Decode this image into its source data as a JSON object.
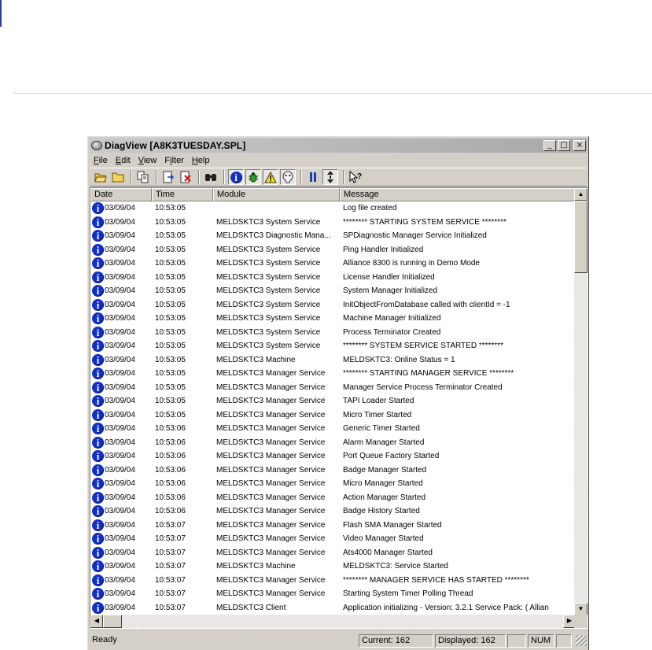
{
  "window": {
    "title": "DiagView [A8K3TUESDAY.SPL]"
  },
  "window_buttons": [
    "minimize",
    "maximize",
    "close"
  ],
  "menu": [
    {
      "label": "File",
      "key": "F"
    },
    {
      "label": "Edit",
      "key": "E"
    },
    {
      "label": "View",
      "key": "V"
    },
    {
      "label": "Filter",
      "key": "i"
    },
    {
      "label": "Help",
      "key": "H"
    }
  ],
  "toolbar": [
    "open-folder-icon",
    "folder-icon",
    "copy-icon",
    "export-icon",
    "delete-icon",
    "find-icon",
    "info-filter-icon",
    "debug-filter-icon",
    "warning-filter-icon",
    "error-filter-icon",
    "pause-icon",
    "autoscroll-icon",
    "context-help-icon"
  ],
  "columns": {
    "date": "Date",
    "time": "Time",
    "module": "Module",
    "message": "Message"
  },
  "rows": [
    {
      "date": "03/09/04",
      "time": "10:53:05",
      "module": "",
      "message": "Log file created"
    },
    {
      "date": "03/09/04",
      "time": "10:53:05",
      "module": "MELDSKTC3 System Service",
      "message": "********  STARTING SYSTEM SERVICE  ********"
    },
    {
      "date": "03/09/04",
      "time": "10:53:05",
      "module": "MELDSKTC3 Diagnostic Mana...",
      "message": "SPDiagnostic Manager Service Initialized"
    },
    {
      "date": "03/09/04",
      "time": "10:53:05",
      "module": "MELDSKTC3 System Service",
      "message": "Ping Handler Initialized"
    },
    {
      "date": "03/09/04",
      "time": "10:53:05",
      "module": "MELDSKTC3 System Service",
      "message": "Alliance 8300 is running in Demo Mode"
    },
    {
      "date": "03/09/04",
      "time": "10:53:05",
      "module": "MELDSKTC3 System Service",
      "message": "License Handler Initialized"
    },
    {
      "date": "03/09/04",
      "time": "10:53:05",
      "module": "MELDSKTC3 System Service",
      "message": "System Manager Initialized"
    },
    {
      "date": "03/09/04",
      "time": "10:53:05",
      "module": "MELDSKTC3 System Service",
      "message": "InitObjectFromDatabase called with clientId = -1"
    },
    {
      "date": "03/09/04",
      "time": "10:53:05",
      "module": "MELDSKTC3 System Service",
      "message": "Machine Manager Initialized"
    },
    {
      "date": "03/09/04",
      "time": "10:53:05",
      "module": "MELDSKTC3 System Service",
      "message": "Process Terminator Created"
    },
    {
      "date": "03/09/04",
      "time": "10:53:05",
      "module": "MELDSKTC3 System Service",
      "message": "********  SYSTEM SERVICE STARTED  ********"
    },
    {
      "date": "03/09/04",
      "time": "10:53:05",
      "module": "MELDSKTC3 Machine",
      "message": "MELDSKTC3: Online Status = 1"
    },
    {
      "date": "03/09/04",
      "time": "10:53:05",
      "module": "MELDSKTC3 Manager Service",
      "message": "********  STARTING MANAGER SERVICE  ********"
    },
    {
      "date": "03/09/04",
      "time": "10:53:05",
      "module": "MELDSKTC3 Manager Service",
      "message": "Manager Service Process Terminator Created"
    },
    {
      "date": "03/09/04",
      "time": "10:53:05",
      "module": "MELDSKTC3 Manager Service",
      "message": "TAPI Loader Started"
    },
    {
      "date": "03/09/04",
      "time": "10:53:05",
      "module": "MELDSKTC3 Manager Service",
      "message": "Micro Timer Started"
    },
    {
      "date": "03/09/04",
      "time": "10:53:06",
      "module": "MELDSKTC3 Manager Service",
      "message": "Generic Timer Started"
    },
    {
      "date": "03/09/04",
      "time": "10:53:06",
      "module": "MELDSKTC3 Manager Service",
      "message": "Alarm Manager Started"
    },
    {
      "date": "03/09/04",
      "time": "10:53:06",
      "module": "MELDSKTC3 Manager Service",
      "message": "Port Queue Factory Started"
    },
    {
      "date": "03/09/04",
      "time": "10:53:06",
      "module": "MELDSKTC3 Manager Service",
      "message": "Badge Manager Started"
    },
    {
      "date": "03/09/04",
      "time": "10:53:06",
      "module": "MELDSKTC3 Manager Service",
      "message": "Micro Manager Started"
    },
    {
      "date": "03/09/04",
      "time": "10:53:06",
      "module": "MELDSKTC3 Manager Service",
      "message": "Action Manager Started"
    },
    {
      "date": "03/09/04",
      "time": "10:53:06",
      "module": "MELDSKTC3 Manager Service",
      "message": "Badge History Started"
    },
    {
      "date": "03/09/04",
      "time": "10:53:07",
      "module": "MELDSKTC3 Manager Service",
      "message": "Flash SMA Manager Started"
    },
    {
      "date": "03/09/04",
      "time": "10:53:07",
      "module": "MELDSKTC3 Manager Service",
      "message": "Video Manager Started"
    },
    {
      "date": "03/09/04",
      "time": "10:53:07",
      "module": "MELDSKTC3 Manager Service",
      "message": "Ats4000 Manager Started"
    },
    {
      "date": "03/09/04",
      "time": "10:53:07",
      "module": "MELDSKTC3 Machine",
      "message": "MELDSKTC3: Service Started"
    },
    {
      "date": "03/09/04",
      "time": "10:53:07",
      "module": "MELDSKTC3 Manager Service",
      "message": "********  MANAGER SERVICE HAS STARTED  ********"
    },
    {
      "date": "03/09/04",
      "time": "10:53:07",
      "module": "MELDSKTC3 Manager Service",
      "message": "Starting System Timer Polling Thread"
    },
    {
      "date": "03/09/04",
      "time": "10:53:07",
      "module": "MELDSKTC3 Client",
      "message": "Application initializing  -  Version: 3.2.1   Service Pack:     ( Allian"
    }
  ],
  "status": {
    "ready": "Ready",
    "current": "Current: 162",
    "displayed": "Displayed: 162",
    "num": "NUM"
  },
  "colors": {
    "info_icon": "#1030c8",
    "rule": "#c7d0de"
  }
}
